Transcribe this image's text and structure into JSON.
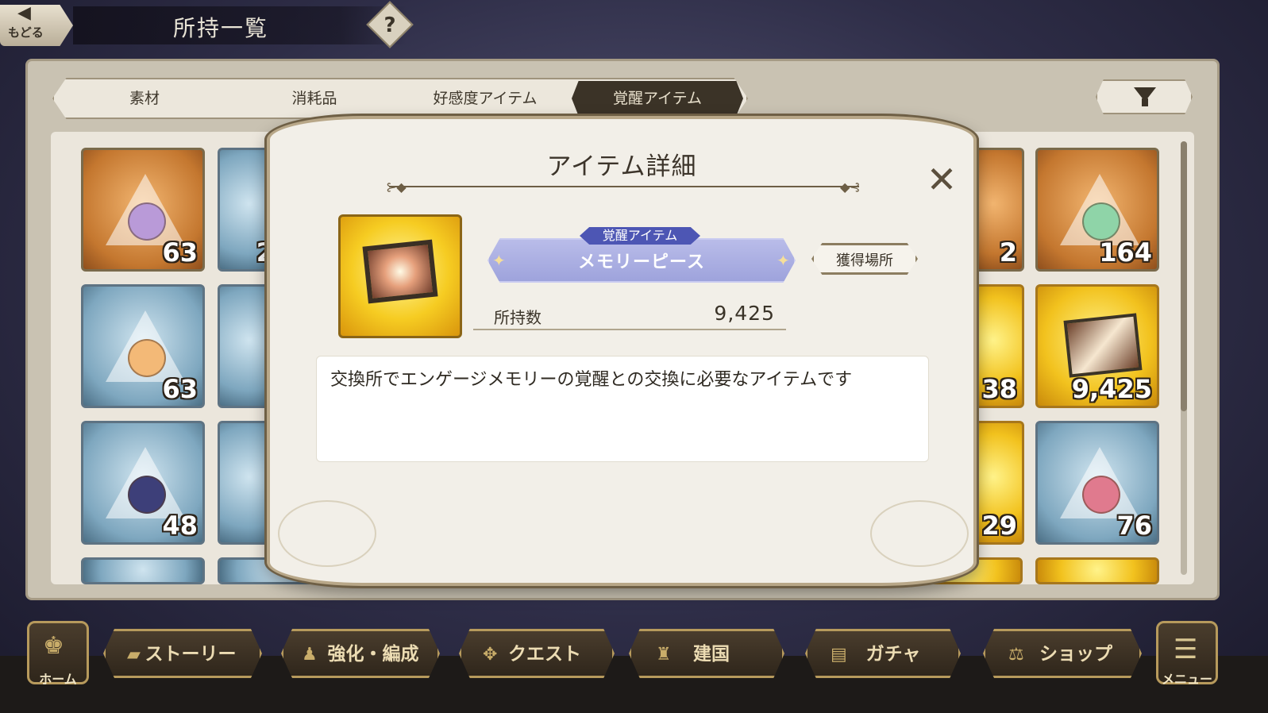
{
  "header": {
    "back_label": "もどる",
    "title": "所持一覧",
    "help": "?"
  },
  "tabs": [
    {
      "label": "素材",
      "active": false
    },
    {
      "label": "消耗品",
      "active": false
    },
    {
      "label": "好感度アイテム",
      "active": false
    },
    {
      "label": "覚醒アイテム",
      "active": true
    }
  ],
  "filter_icon": "funnel-icon",
  "grid": {
    "cells": [
      {
        "style": "orange",
        "count": "63"
      },
      {
        "style": "blue",
        "count": "2"
      },
      {
        "style": "orange",
        "count": "2"
      },
      {
        "style": "orange",
        "count": "164"
      },
      {
        "style": "blue",
        "count": "63"
      },
      {
        "style": "blue",
        "count": ""
      },
      {
        "style": "gold",
        "count": "38"
      },
      {
        "style": "gold",
        "count": "9,425"
      },
      {
        "style": "blue",
        "count": "48"
      },
      {
        "style": "blue",
        "count": ""
      },
      {
        "style": "gold",
        "count": "29"
      },
      {
        "style": "blue",
        "count": "76"
      }
    ]
  },
  "modal": {
    "title": "アイテム詳細",
    "category": "覚醒アイテム",
    "item_name": "メモリーピース",
    "source_button": "獲得場所",
    "owned_label": "所持数",
    "owned_value": "9,425",
    "description": "交換所でエンゲージメモリーの覚醒との交換に必要なアイテムです",
    "close_icon": "close-icon"
  },
  "nav": {
    "home": "ホーム",
    "items": [
      {
        "label": "ストーリー",
        "icon": "book-icon"
      },
      {
        "label": "強化・編成",
        "icon": "party-icon"
      },
      {
        "label": "クエスト",
        "icon": "compass-icon"
      },
      {
        "label": "建国",
        "icon": "castle-icon"
      },
      {
        "label": "ガチャ",
        "icon": "ticket-icon"
      },
      {
        "label": "ショップ",
        "icon": "scale-icon"
      }
    ],
    "menu": "メニュー"
  }
}
